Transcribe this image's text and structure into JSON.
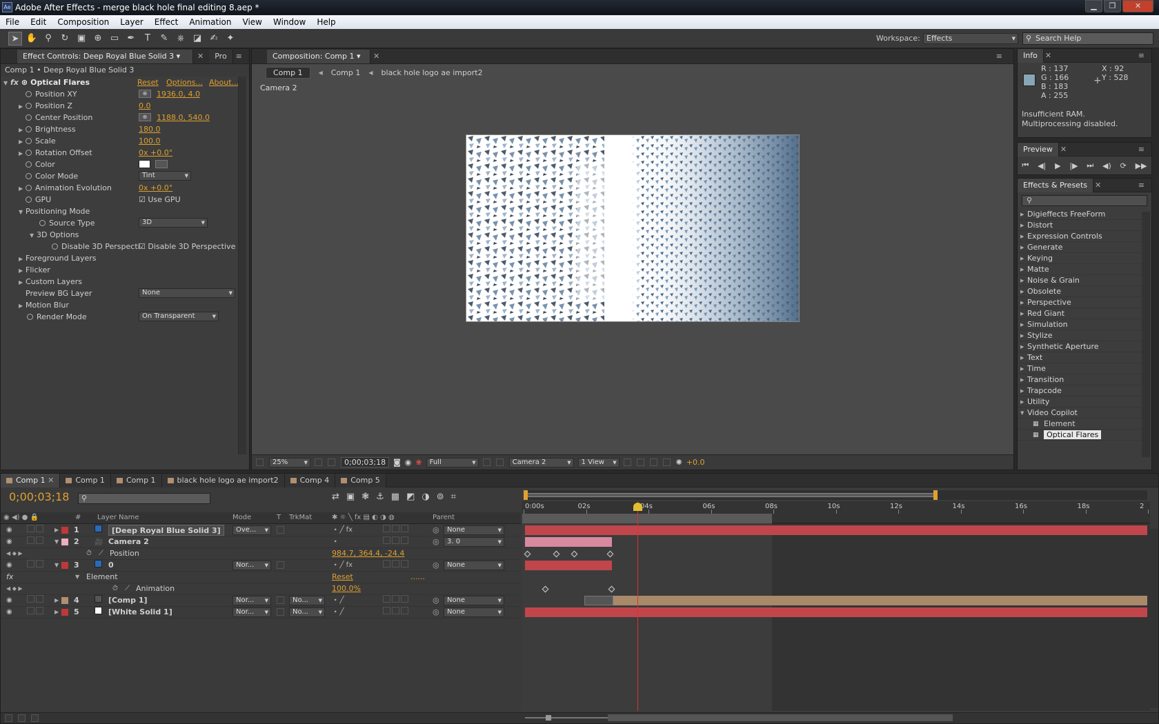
{
  "window": {
    "title": "Adobe After Effects - merge black hole final editing 8.aep *",
    "app_icon": "Ae"
  },
  "window_controls": {
    "min": "▁",
    "max": "❐",
    "close": "✕"
  },
  "menu": [
    "File",
    "Edit",
    "Composition",
    "Layer",
    "Effect",
    "Animation",
    "View",
    "Window",
    "Help"
  ],
  "toolbar": {
    "tools": [
      "select-tool",
      "hand-tool",
      "zoom-tool",
      "rotate-tool",
      "camera-tool",
      "pan-behind-tool",
      "rect-tool",
      "pen-tool",
      "type-tool",
      "brush-tool",
      "clone-tool",
      "eraser-tool",
      "roto-tool",
      "puppet-tool"
    ],
    "workspace_label": "Workspace:",
    "workspace_value": "Effects",
    "search_placeholder": "Search Help"
  },
  "effect_controls": {
    "tab": "Effect Controls: Deep Royal Blue Solid 3",
    "tab2": "Pro",
    "breadcrumb": "Comp 1 • Deep Royal Blue Solid 3",
    "effect_name": "Optical Flares",
    "reset": "Reset",
    "options": "Options...",
    "about": "About...",
    "props": [
      {
        "label": "Position XY",
        "value": "1936.0, 4.0",
        "crosshair": true,
        "tri": false,
        "indent": 0
      },
      {
        "label": "Position Z",
        "value": "0.0",
        "tri": true,
        "indent": 0
      },
      {
        "label": "Center Position",
        "value": "1188.0, 540.0",
        "crosshair": true,
        "tri": false,
        "indent": 0
      },
      {
        "label": "Brightness",
        "value": "180.0",
        "tri": true,
        "indent": 0
      },
      {
        "label": "Scale",
        "value": "100.0",
        "tri": true,
        "indent": 0
      },
      {
        "label": "Rotation Offset",
        "value": "0x +0.0°",
        "tri": true,
        "indent": 0
      },
      {
        "label": "Color",
        "value": "",
        "color": "#ffffff",
        "tri": false,
        "indent": 0
      },
      {
        "label": "Color Mode",
        "value": "",
        "select": "Tint",
        "tri": false,
        "indent": 0
      },
      {
        "label": "Animation Evolution",
        "value": "0x +0.0°",
        "tri": true,
        "indent": 0
      },
      {
        "label": "GPU",
        "value": "",
        "check": "Use GPU",
        "tri": false,
        "indent": 0
      }
    ],
    "positioning_mode": "Positioning Mode",
    "source_type_label": "Source Type",
    "source_type_value": "3D",
    "options_3d": "3D Options",
    "disable_label": "Disable 3D Perspecti",
    "disable_check": "Disable 3D Perspective",
    "groups": [
      "Foreground Layers",
      "Flicker",
      "Custom Layers"
    ],
    "preview_bg_label": "Preview BG Layer",
    "preview_bg_value": "None",
    "motion_blur": "Motion Blur",
    "render_mode_label": "Render Mode",
    "render_mode_value": "On Transparent"
  },
  "composition": {
    "tab": "Composition: Comp 1",
    "crumbs": [
      "Comp 1",
      "Comp 1",
      "black hole logo ae import2"
    ],
    "camera_label": "Camera 2",
    "footer": {
      "zoom": "25%",
      "timecode": "0;00;03;18",
      "resolution": "Full",
      "camera": "Camera 2",
      "views": "1 View",
      "exposure": "+0.0"
    }
  },
  "info": {
    "tab": "Info",
    "r": "R : 137",
    "g": "G : 166",
    "b": "B : 183",
    "a": "A : 255",
    "x": "X : 92",
    "y": "Y : 528",
    "msg1": "Insufficient RAM.",
    "msg2": "Multiprocessing disabled.",
    "swatch": "#89a6b7"
  },
  "preview": {
    "tab": "Preview"
  },
  "effects_presets": {
    "tab": "Effects & Presets",
    "items": [
      "Digieffects FreeForm",
      "Distort",
      "Expression Controls",
      "Generate",
      "Keying",
      "Matte",
      "Noise & Grain",
      "Obsolete",
      "Perspective",
      "Red Giant",
      "Simulation",
      "Stylize",
      "Synthetic Aperture",
      "Text",
      "Time",
      "Transition",
      "Trapcode",
      "Utility"
    ],
    "open_folder": "Video Copilot",
    "sub": [
      "Element",
      "Optical Flares"
    ]
  },
  "timeline": {
    "tabs": [
      "Comp 1",
      "Comp 1",
      "Comp 1",
      "black hole logo ae import2",
      "Comp 4",
      "Comp 5"
    ],
    "timecode": "0;00;03;18",
    "col_headers": {
      "layer_name": "Layer Name",
      "mode": "Mode",
      "t": "T",
      "trkmat": "TrkMat",
      "parent": "Parent"
    },
    "ruler": [
      "0:00s",
      "02s",
      "04s",
      "06s",
      "08s",
      "10s",
      "12s",
      "14s",
      "16s",
      "18s",
      "2"
    ],
    "layers": [
      {
        "num": "1",
        "name": "[Deep Royal Blue Solid 3]",
        "mode": "Ove...",
        "parent": "None",
        "chip": "#2a6ab8",
        "label": "#c03838"
      },
      {
        "num": "2",
        "name": "Camera 2",
        "mode": "",
        "parent": "3. 0",
        "chip": "",
        "label": "#e8b0c0"
      },
      {
        "num": "",
        "name": "Position",
        "value": "984.7, 364.4, -24.4",
        "sub": true
      },
      {
        "num": "3",
        "name": "0",
        "mode": "Nor...",
        "parent": "None",
        "chip": "#2a6ab8",
        "label": "#c03838"
      },
      {
        "num": "",
        "name": "Element",
        "value": "Reset",
        "fx": true
      },
      {
        "num": "",
        "name": "Animation",
        "value": "100.0%",
        "sub2": true
      },
      {
        "num": "4",
        "name": "[Comp 1]",
        "mode": "Nor...",
        "trk": "No...",
        "parent": "None",
        "chip": "comp",
        "label": "#b09070"
      },
      {
        "num": "5",
        "name": "[White Solid 1]",
        "mode": "Nor...",
        "trk": "No...",
        "parent": "None",
        "chip": "#ffffff",
        "label": "#c03838"
      }
    ],
    "keys_dots": "......"
  },
  "colors": {
    "accent_orange": "#e0a030",
    "layer_red": "#c0464c",
    "camera_pink": "#d889a0",
    "comp_tan": "#a88a6a",
    "playhead": "#e03030"
  }
}
